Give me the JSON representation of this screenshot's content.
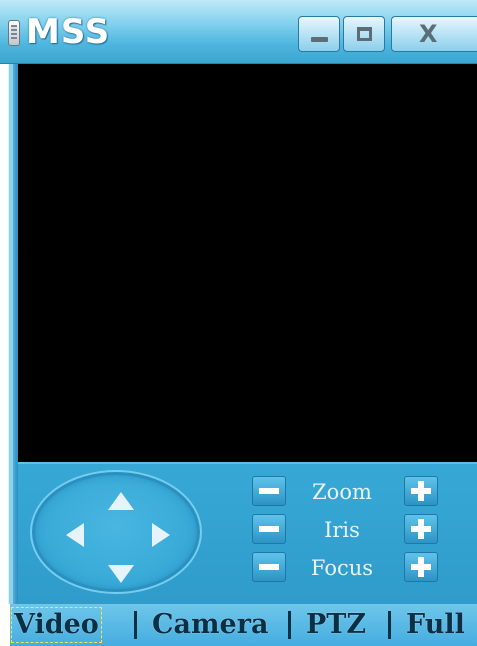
{
  "window": {
    "title": "MSS",
    "minimize_symbol": "",
    "maximize_symbol": "",
    "close_symbol": "X"
  },
  "video": {
    "state": "no signal (black)"
  },
  "controls": {
    "zoom_label": "Zoom",
    "iris_label": "Iris",
    "focus_label": "Focus"
  },
  "tabs": [
    {
      "label": "Video",
      "selected": true
    },
    {
      "label": "Camera",
      "selected": false
    },
    {
      "label": "PTZ",
      "selected": false
    },
    {
      "label": "Full",
      "selected": false
    }
  ],
  "colors": {
    "title_bar": "#4fb6de",
    "panel": "#37a8d6",
    "video_bg": "#000000",
    "focus_outline": "#f5e84a"
  },
  "icons": {
    "app": "mss-app-icon",
    "minimize": "minimize-icon",
    "maximize": "maximize-icon",
    "close": "close-icon",
    "up": "arrow-up-icon",
    "down": "arrow-down-icon",
    "left": "arrow-left-icon",
    "right": "arrow-right-icon",
    "minus": "minus-icon",
    "plus": "plus-icon"
  }
}
